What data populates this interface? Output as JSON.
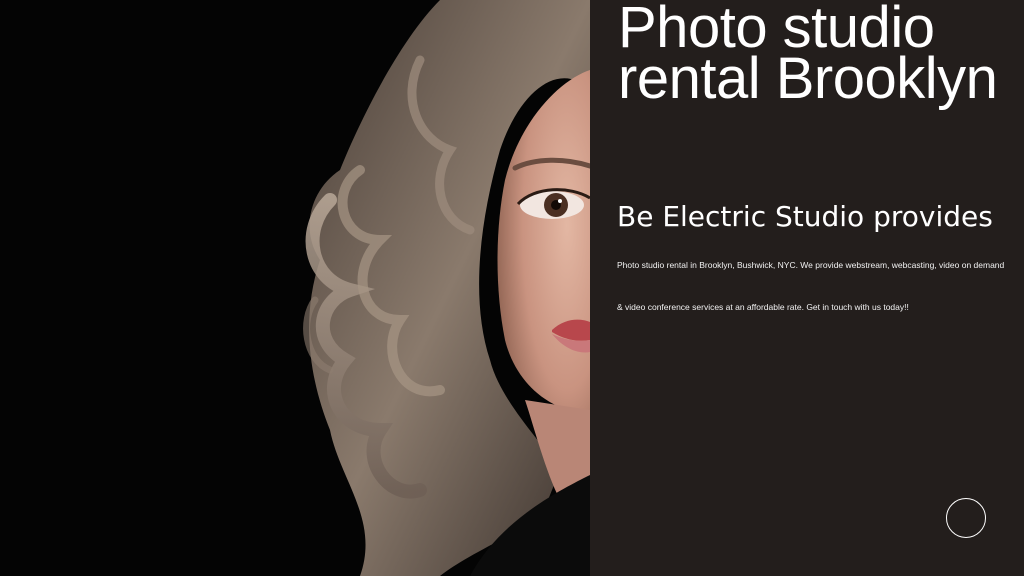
{
  "hero": {
    "title": "Photo studio rental Brooklyn",
    "lead": "Be Electric Studio provides",
    "body": " Photo studio rental in Brooklyn, Bushwick, NYC. We provide webstream, webcasting, video on demand & video conference services at an affordable rate. Get in touch with us today!!"
  },
  "colors": {
    "panel_background": "#231e1c",
    "text": "#ffffff",
    "photo_background": "#050505"
  },
  "icons": {
    "circle_button": "circle-outline-icon"
  }
}
